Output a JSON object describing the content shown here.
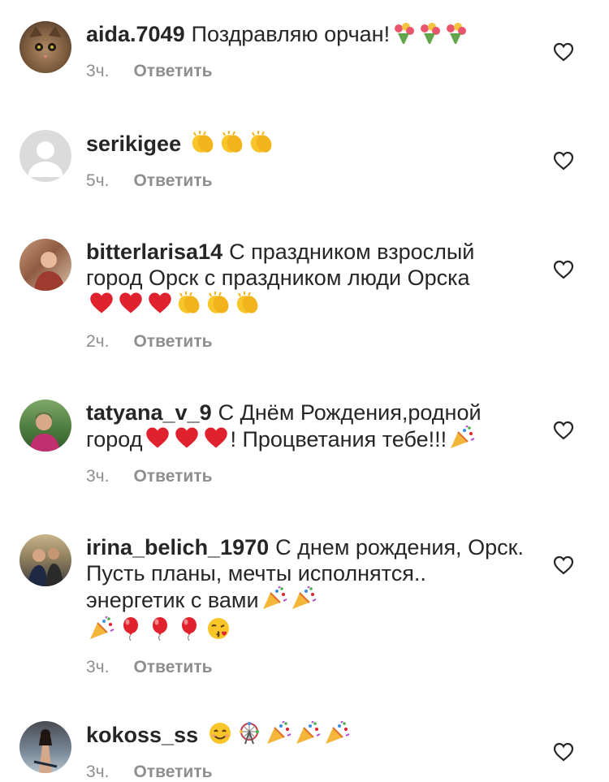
{
  "reply_label": "Ответить",
  "comments": [
    {
      "username": "aida.7049",
      "text": "Поздравляю орчан!",
      "emoji": [
        "tulip-bouquet",
        "tulip-bouquet",
        "tulip-bouquet"
      ],
      "time": "3ч.",
      "avatar": "cat-photo"
    },
    {
      "username": "serikigee",
      "text": "",
      "emoji": [
        "clap",
        "clap",
        "clap"
      ],
      "time": "5ч.",
      "avatar": "default-profile"
    },
    {
      "username": "bitterlarisa14",
      "text": "С праздником  взрослый город Орск  с праздником люди Орска",
      "emoji": [
        "heart",
        "heart",
        "heart",
        "clap",
        "clap",
        "clap"
      ],
      "time": "2ч.",
      "avatar": "person-photo"
    },
    {
      "username": "tatyana_v_9",
      "text": "С Днём Рождения,родной город",
      "text_tail": "! Процветания тебе!!!",
      "emoji": [
        "heart",
        "heart",
        "heart"
      ],
      "tail_emoji": [
        "party-popper"
      ],
      "time": "3ч.",
      "avatar": "person-photo"
    },
    {
      "username": "irina_belich_1970",
      "text": "С днем рождения, Орск. Пусть планы, мечты исполнятся.. энергетик с вами",
      "emoji": [
        "party-popper",
        "party-popper",
        "party-popper",
        "balloon",
        "balloon",
        "balloon",
        "kiss-face"
      ],
      "time": "3ч.",
      "avatar": "couple-photo"
    },
    {
      "username": "kokoss_ss",
      "text": "",
      "emoji": [
        "smile",
        "ferris-wheel",
        "party-popper",
        "party-popper",
        "party-popper"
      ],
      "time": "3ч.",
      "avatar": "person-photo"
    }
  ]
}
